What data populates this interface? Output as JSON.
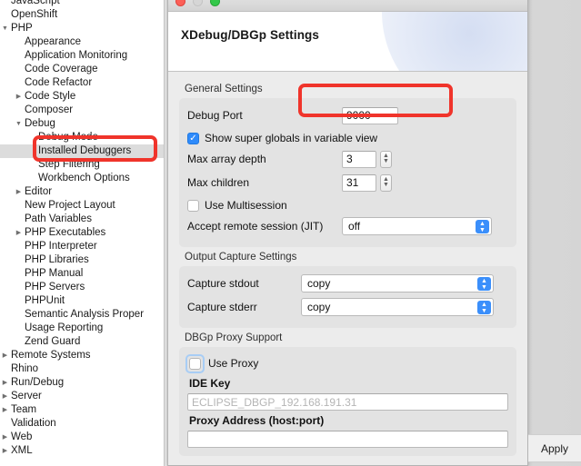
{
  "sidebar": {
    "items": [
      {
        "label": "JavaScript",
        "indent": 0,
        "twisty": "none",
        "selected": false
      },
      {
        "label": "OpenShift",
        "indent": 0,
        "twisty": "none",
        "selected": false
      },
      {
        "label": "PHP",
        "indent": 0,
        "twisty": "down",
        "selected": false
      },
      {
        "label": "Appearance",
        "indent": 1,
        "twisty": "none",
        "selected": false
      },
      {
        "label": "Application Monitoring",
        "indent": 1,
        "twisty": "none",
        "selected": false
      },
      {
        "label": "Code Coverage",
        "indent": 1,
        "twisty": "none",
        "selected": false
      },
      {
        "label": "Code Refactor",
        "indent": 1,
        "twisty": "none",
        "selected": false
      },
      {
        "label": "Code Style",
        "indent": 1,
        "twisty": "right",
        "selected": false
      },
      {
        "label": "Composer",
        "indent": 1,
        "twisty": "none",
        "selected": false
      },
      {
        "label": "Debug",
        "indent": 1,
        "twisty": "down",
        "selected": false
      },
      {
        "label": "Debug Mode",
        "indent": 2,
        "twisty": "none",
        "selected": false
      },
      {
        "label": "Installed Debuggers",
        "indent": 2,
        "twisty": "none",
        "selected": true
      },
      {
        "label": "Step Filtering",
        "indent": 2,
        "twisty": "none",
        "selected": false
      },
      {
        "label": "Workbench Options",
        "indent": 2,
        "twisty": "none",
        "selected": false
      },
      {
        "label": "Editor",
        "indent": 1,
        "twisty": "right",
        "selected": false
      },
      {
        "label": "New Project Layout",
        "indent": 1,
        "twisty": "none",
        "selected": false
      },
      {
        "label": "Path Variables",
        "indent": 1,
        "twisty": "none",
        "selected": false
      },
      {
        "label": "PHP Executables",
        "indent": 1,
        "twisty": "right",
        "selected": false
      },
      {
        "label": "PHP Interpreter",
        "indent": 1,
        "twisty": "none",
        "selected": false
      },
      {
        "label": "PHP Libraries",
        "indent": 1,
        "twisty": "none",
        "selected": false
      },
      {
        "label": "PHP Manual",
        "indent": 1,
        "twisty": "none",
        "selected": false
      },
      {
        "label": "PHP Servers",
        "indent": 1,
        "twisty": "none",
        "selected": false
      },
      {
        "label": "PHPUnit",
        "indent": 1,
        "twisty": "none",
        "selected": false
      },
      {
        "label": "Semantic Analysis Proper",
        "indent": 1,
        "twisty": "none",
        "selected": false
      },
      {
        "label": "Usage Reporting",
        "indent": 1,
        "twisty": "none",
        "selected": false
      },
      {
        "label": "Zend Guard",
        "indent": 1,
        "twisty": "none",
        "selected": false
      },
      {
        "label": "Remote Systems",
        "indent": 0,
        "twisty": "right",
        "selected": false
      },
      {
        "label": "Rhino",
        "indent": 0,
        "twisty": "none",
        "selected": false
      },
      {
        "label": "Run/Debug",
        "indent": 0,
        "twisty": "right",
        "selected": false
      },
      {
        "label": "Server",
        "indent": 0,
        "twisty": "right",
        "selected": false
      },
      {
        "label": "Team",
        "indent": 0,
        "twisty": "right",
        "selected": false
      },
      {
        "label": "Validation",
        "indent": 0,
        "twisty": "none",
        "selected": false
      },
      {
        "label": "Web",
        "indent": 0,
        "twisty": "right",
        "selected": false
      },
      {
        "label": "XML",
        "indent": 0,
        "twisty": "right",
        "selected": false
      }
    ]
  },
  "dialog": {
    "header_title": "XDebug/DBGp Settings",
    "general": {
      "section_label": "General Settings",
      "debug_port_label": "Debug Port",
      "debug_port_value": "9000",
      "show_super_globals_label": "Show super globals in variable view",
      "show_super_globals_checked": true,
      "max_array_depth_label": "Max array depth",
      "max_array_depth_value": "3",
      "max_children_label": "Max children",
      "max_children_value": "31",
      "use_multisession_label": "Use Multisession",
      "use_multisession_checked": false,
      "accept_remote_label": "Accept remote session (JIT)",
      "accept_remote_value": "off"
    },
    "output": {
      "section_label": "Output Capture Settings",
      "capture_stdout_label": "Capture stdout",
      "capture_stdout_value": "copy",
      "capture_stderr_label": "Capture stderr",
      "capture_stderr_value": "copy"
    },
    "proxy": {
      "section_label": "DBGp Proxy Support",
      "use_proxy_label": "Use Proxy",
      "use_proxy_checked": false,
      "ide_key_label": "IDE Key",
      "ide_key_placeholder": "ECLIPSE_DBGP_192.168.191.31",
      "ide_key_value": "",
      "proxy_address_label": "Proxy Address (host:port)",
      "proxy_address_value": ""
    }
  },
  "footer": {
    "apply_label": "Apply"
  },
  "colors": {
    "accent_blue": "#2f8bfb",
    "highlight_red": "#f0342b",
    "selection_gray": "#dcdcdc"
  }
}
